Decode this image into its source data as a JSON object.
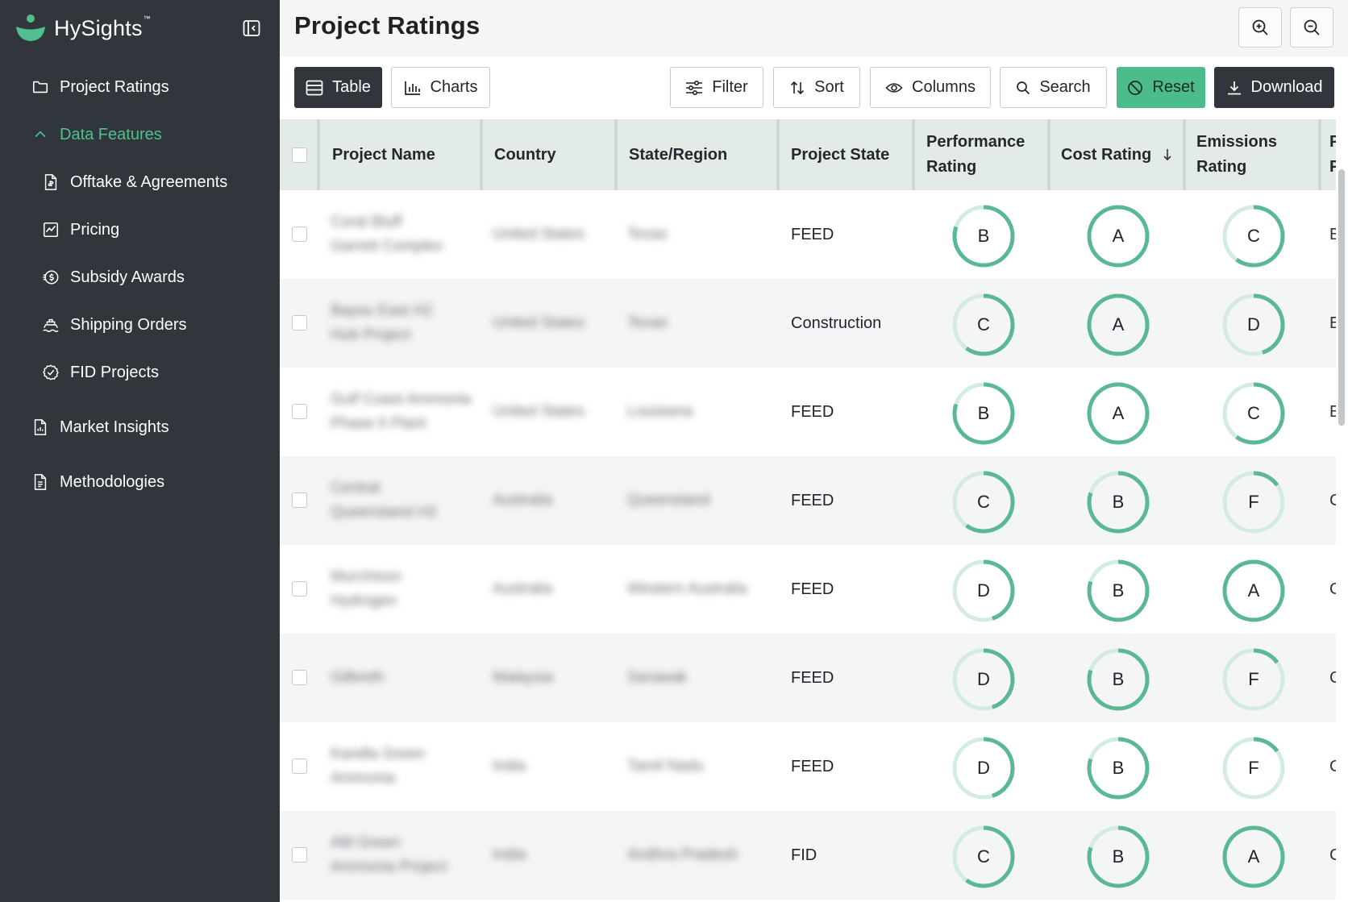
{
  "brand": {
    "name": "HySights",
    "tm": "™"
  },
  "colors": {
    "sidebar_bg": "#30363c",
    "accent": "#4fc08d",
    "header_bg": "#f7f5f3",
    "table_header_bg": "#e3ebe6",
    "ring": "#5ab893"
  },
  "sidebar": {
    "collapse_icon": "panel-collapse-icon",
    "items": [
      {
        "label": "Project Ratings",
        "icon": "folder-icon"
      },
      {
        "label": "Data Features",
        "icon": "chevron-up-icon",
        "expanded": true
      },
      {
        "label": "Offtake & Agreements",
        "icon": "document-icon"
      },
      {
        "label": "Pricing",
        "icon": "chart-line-icon"
      },
      {
        "label": "Subsidy Awards",
        "icon": "dollar-coin-icon"
      },
      {
        "label": "Shipping Orders",
        "icon": "ship-icon"
      },
      {
        "label": "FID Projects",
        "icon": "check-circle-icon"
      },
      {
        "label": "Market Insights",
        "icon": "report-icon"
      },
      {
        "label": "Methodologies",
        "icon": "report-icon"
      }
    ]
  },
  "header": {
    "title": "Project Ratings",
    "zoom_in_icon": "zoom-in-icon",
    "zoom_out_icon": "zoom-out-icon"
  },
  "toolbar": {
    "table": "Table",
    "charts": "Charts",
    "filter": "Filter",
    "sort": "Sort",
    "columns": "Columns",
    "search": "Search",
    "reset": "Reset",
    "download": "Download"
  },
  "table": {
    "columns": [
      "Project Name",
      "Country",
      "State/Region",
      "Project State",
      "Performance Rating",
      "Cost Rating",
      "Emissions Rating"
    ],
    "performance_rating_lines": [
      "Performance",
      "Rating"
    ],
    "emissions_rating_lines": [
      "Emissions",
      "Rating"
    ],
    "sorted_column": "Cost Rating",
    "sort_direction": "descending",
    "rows": [
      {
        "name": [
          "Coral Bluff",
          "Garrett Complex"
        ],
        "country": "United States",
        "region": "Texas",
        "state": "FEED",
        "perf": "B",
        "cost": "A",
        "emis": "C",
        "trailing": "E"
      },
      {
        "name": [
          "Bayou East H2",
          "Hub Project"
        ],
        "country": "United States",
        "region": "Texas",
        "state": "Construction",
        "perf": "C",
        "cost": "A",
        "emis": "D",
        "trailing": "E"
      },
      {
        "name": [
          "Gulf Coast Ammonia",
          "Phase II Plant"
        ],
        "country": "United States",
        "region": "Louisiana",
        "state": "FEED",
        "perf": "B",
        "cost": "A",
        "emis": "C",
        "trailing": "E"
      },
      {
        "name": [
          "Central",
          "Queensland H2"
        ],
        "country": "Australia",
        "region": "Queensland",
        "state": "FEED",
        "perf": "C",
        "cost": "B",
        "emis": "F",
        "trailing": "C"
      },
      {
        "name": [
          "Murchison",
          "Hydrogen"
        ],
        "country": "Australia",
        "region": "Western Australia",
        "state": "FEED",
        "perf": "D",
        "cost": "B",
        "emis": "A",
        "trailing": "C"
      },
      {
        "name": [
          "Gilbreth"
        ],
        "country": "Malaysia",
        "region": "Sarawak",
        "state": "FEED",
        "perf": "D",
        "cost": "B",
        "emis": "F",
        "trailing": "C"
      },
      {
        "name": [
          "Kandla Green",
          "Ammonia"
        ],
        "country": "India",
        "region": "Tamil Nadu",
        "state": "FEED",
        "perf": "D",
        "cost": "B",
        "emis": "F",
        "trailing": "C"
      },
      {
        "name": [
          "AM Green",
          "Ammonia Project"
        ],
        "country": "India",
        "region": "Andhra Pradesh",
        "state": "FID",
        "perf": "C",
        "cost": "B",
        "emis": "A",
        "trailing": "C"
      }
    ]
  }
}
